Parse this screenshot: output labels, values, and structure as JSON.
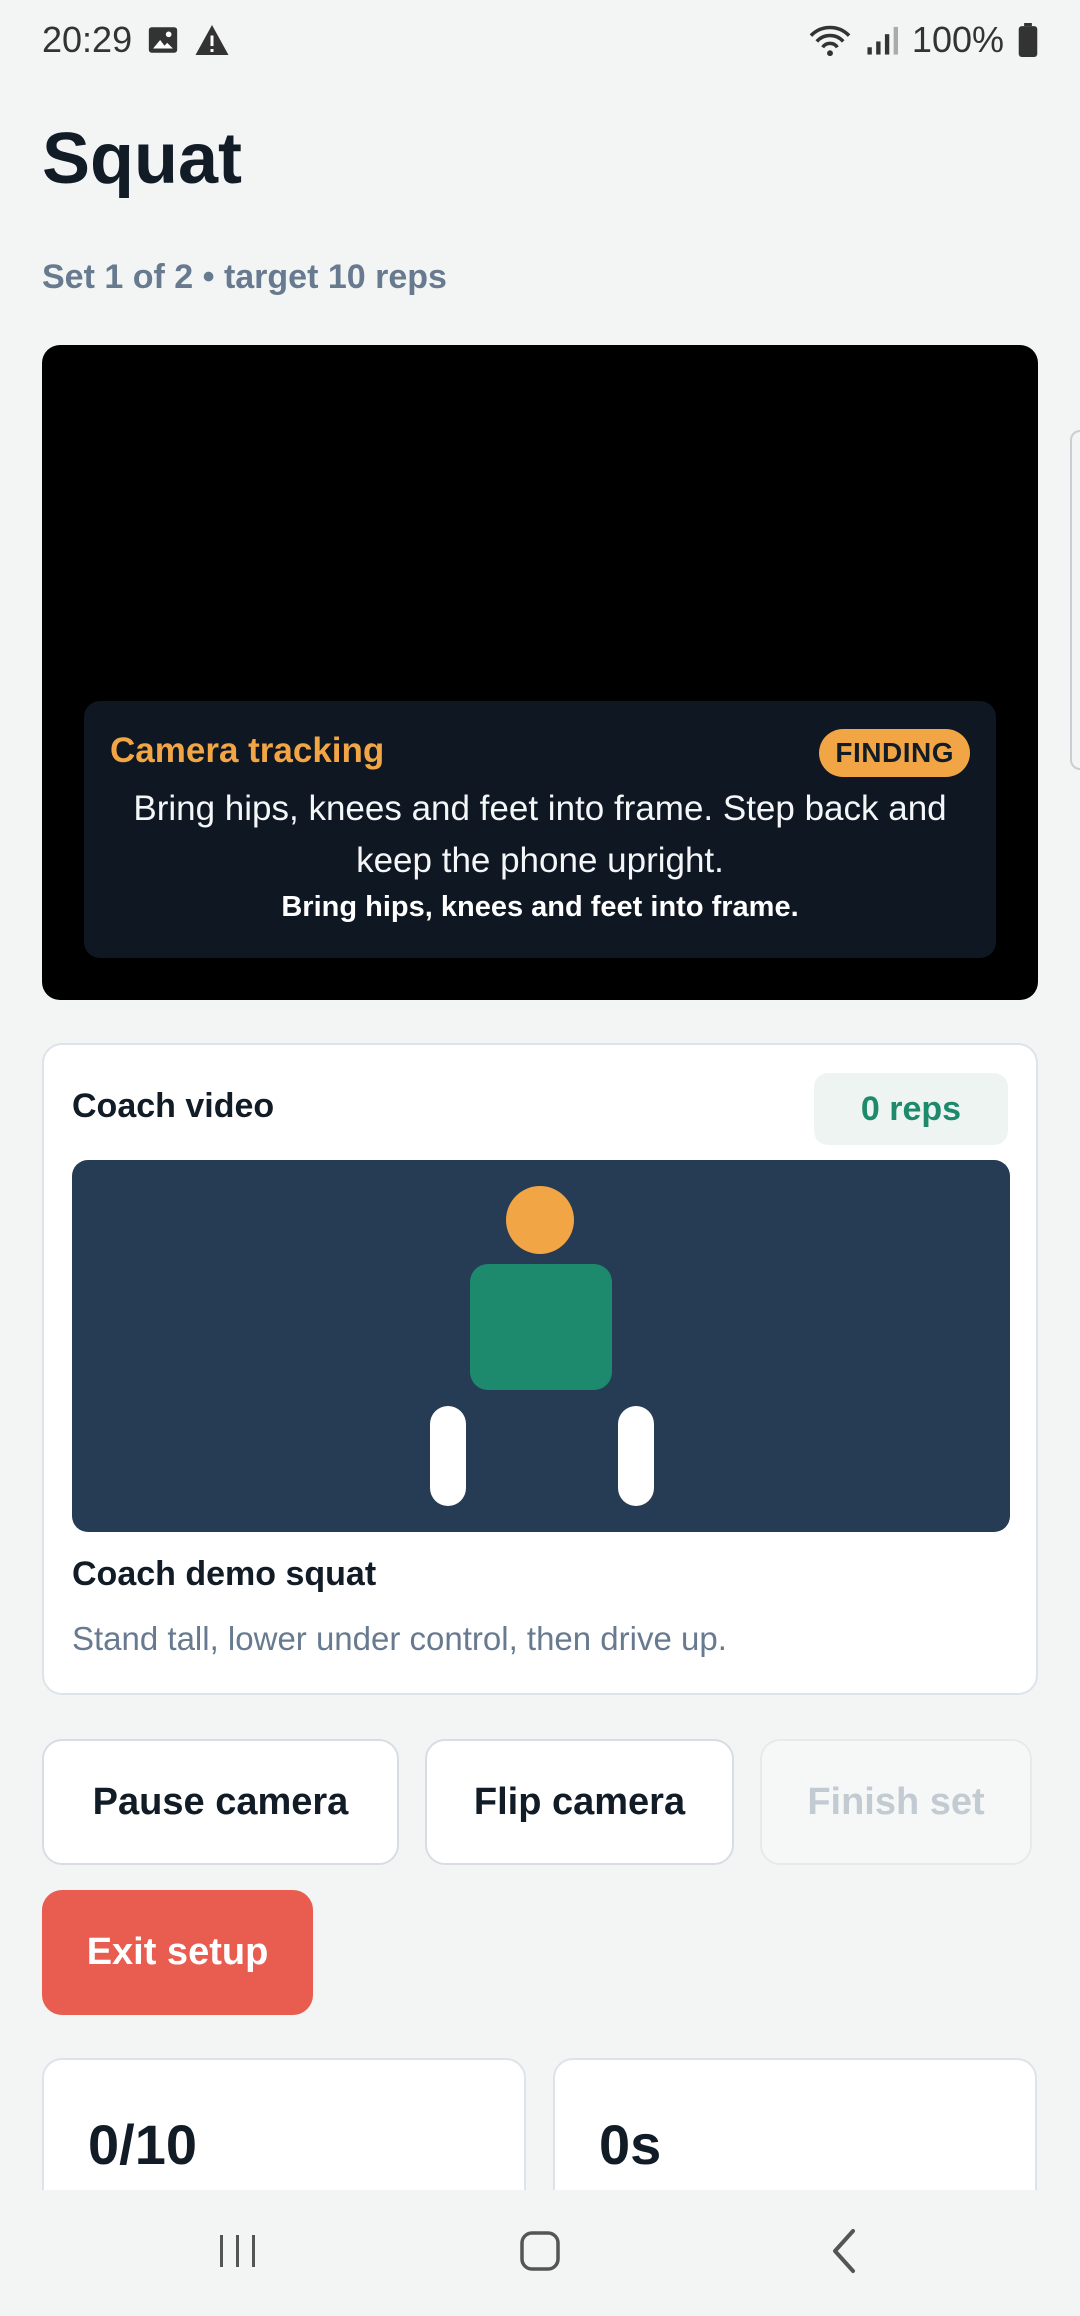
{
  "status_bar": {
    "time": "20:29",
    "battery_percent": "100%",
    "icons": [
      "image-icon",
      "alert-icon",
      "wifi-icon",
      "signal-icon",
      "battery-icon"
    ]
  },
  "header": {
    "title": "Squat",
    "subtitle": "Set 1 of 2 • target 10 reps"
  },
  "camera": {
    "tracking_title": "Camera tracking",
    "status_badge": "FINDING",
    "message": "Bring hips, knees and feet into frame. Step back and keep the phone upright.",
    "hint": "Bring hips, knees and feet into frame."
  },
  "coach": {
    "title": "Coach video",
    "reps": "0 reps",
    "caption": "Coach demo squat",
    "description": "Stand tall, lower under control, then drive up."
  },
  "actions": {
    "pause": "Pause camera",
    "flip": "Flip camera",
    "finish": "Finish set",
    "exit": "Exit setup"
  },
  "stats": {
    "reps_progress": "0/10",
    "elapsed": "0s"
  },
  "colors": {
    "accent_orange": "#f2a544",
    "accent_green": "#1d8a6c",
    "danger": "#e85d50",
    "coach_bg": "#263b54"
  }
}
